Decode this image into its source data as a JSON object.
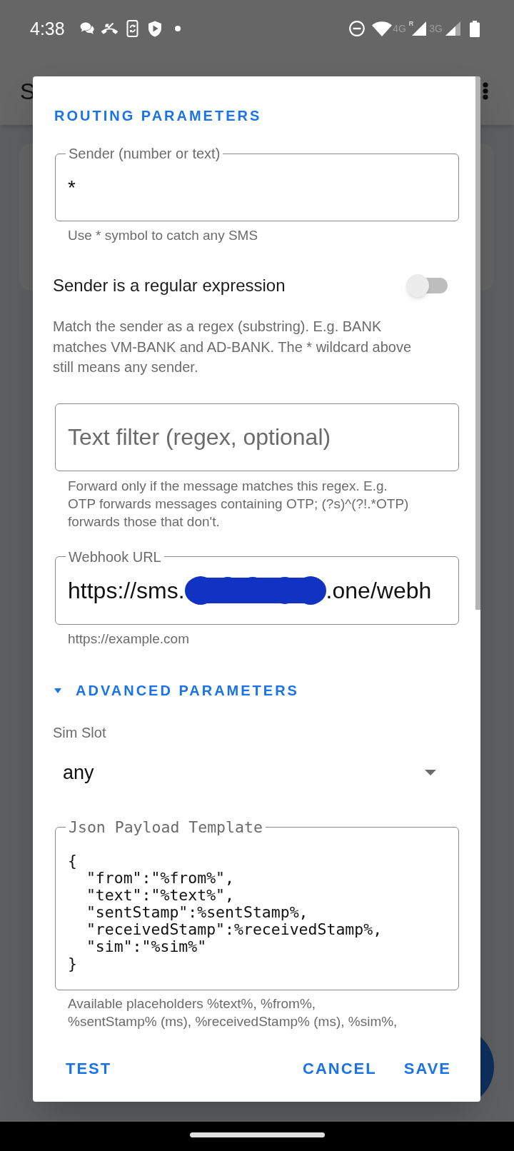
{
  "status_bar": {
    "time": "4:38",
    "networks": [
      {
        "label": "4G",
        "roaming": "R"
      },
      {
        "label": "3G"
      }
    ]
  },
  "app_bar": {
    "title": "S"
  },
  "dialog": {
    "routing": {
      "heading": "ROUTING PARAMETERS",
      "sender": {
        "label": "Sender (number or text)",
        "value": "*",
        "helper": "Use * symbol to catch any SMS"
      },
      "regex_switch": {
        "label": "Sender is a regular expression",
        "on": false,
        "description": "Match the sender as a regex (substring). E.g. BANK matches VM-BANK and AD-BANK. The * wildcard above still means any sender."
      },
      "text_filter": {
        "placeholder": "Text filter (regex, optional)",
        "helper": "Forward only if the message matches this regex. E.g. OTP forwards messages containing OTP; (?s)^(?!.*OTP) forwards those that don't."
      },
      "webhook": {
        "label": "Webhook URL",
        "value_start": "https://sms.",
        "redacted": true,
        "value_end": ".one/webh",
        "helper": "https://example.com"
      }
    },
    "advanced": {
      "heading": "ADVANCED PARAMETERS",
      "expanded": true,
      "sim_slot": {
        "label": "Sim Slot",
        "value": "any"
      },
      "json_template": {
        "label": "Json Payload Template",
        "value": "{\n  \"from\":\"%from%\",\n  \"text\":\"%text%\",\n  \"sentStamp\":%sentStamp%,\n  \"receivedStamp\":%receivedStamp%,\n  \"sim\":\"%sim%\"\n}",
        "helper": "Available placeholders %text%, %from%,\n%sentStamp% (ms), %receivedStamp% (ms), %sim%,"
      }
    },
    "buttons": {
      "neutral": "TEST",
      "negative": "CANCEL",
      "positive": "SAVE"
    }
  }
}
